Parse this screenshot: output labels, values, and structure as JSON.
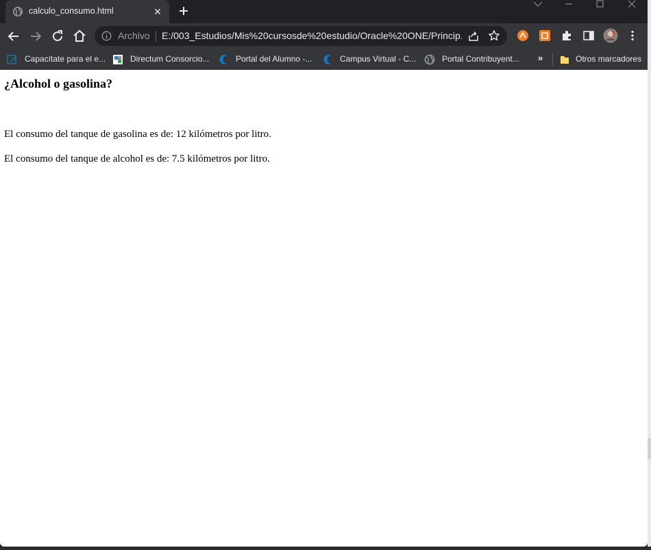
{
  "tab": {
    "title": "calculo_consumo.html"
  },
  "address_bar": {
    "scheme_label": "Archivo",
    "url": "E:/003_Estudios/Mis%20cursosde%20estudio/Oracle%20ONE/Princip..."
  },
  "bookmarks": {
    "items": [
      {
        "label": "Capacítate para el e...",
        "icon": "bookmark-page-icon"
      },
      {
        "label": "Directum Consorcio...",
        "icon": "directum-icon"
      },
      {
        "label": "Portal del Alumno -...",
        "icon": "crescent-logo-icon"
      },
      {
        "label": "Campus Virtual - C...",
        "icon": "crescent-logo-icon"
      },
      {
        "label": "Portal Contribuyent...",
        "icon": "globe-icon"
      }
    ],
    "more_label": "»",
    "folder_label": "Otros marcadores"
  },
  "page": {
    "heading": "¿Alcohol o gasolina?",
    "line1": "El consumo del tanque de gasolina es de: 12 kilómetros por litro.",
    "line2": "El consumo del tanque de alcohol es de: 7.5 kilómetros por litro."
  },
  "colors": {
    "chrome_dark": "#202124",
    "chrome_toolbar": "#35363a",
    "chrome_text": "#e8eaed",
    "ext_orange": "#f57c1f",
    "page_bg": "#ffffff"
  }
}
